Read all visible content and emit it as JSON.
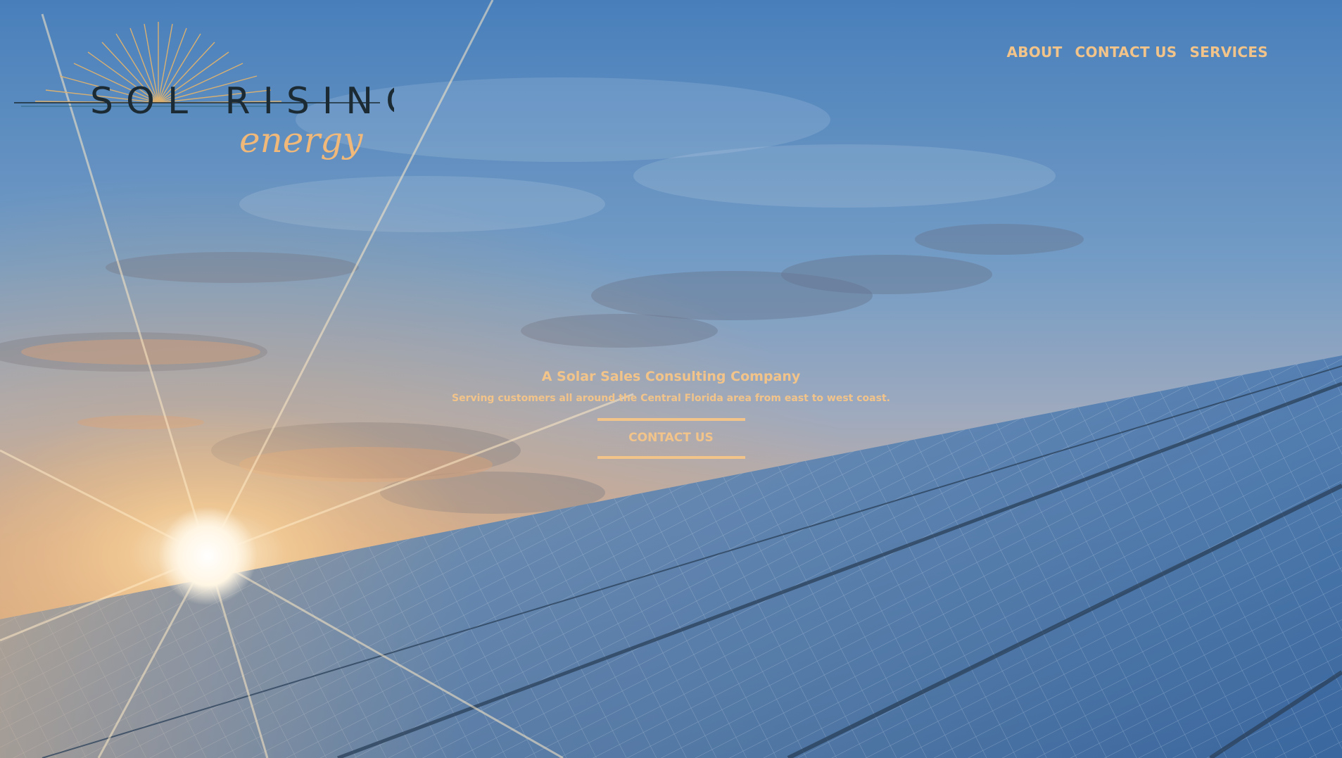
{
  "brand": {
    "logo_word_top": "SOL RISING",
    "logo_word_bottom": "energy",
    "colors": {
      "accent": "#f2c48a",
      "logo_dark": "#1b2a33"
    }
  },
  "nav": {
    "items": [
      {
        "label": "ABOUT"
      },
      {
        "label": "CONTACT US"
      },
      {
        "label": "SERVICES"
      }
    ]
  },
  "hero": {
    "title": "A Solar Sales Consulting Company",
    "subtitle": "Serving customers all around the Central Florida area from east to west coast.",
    "cta_label": "CONTACT US"
  }
}
